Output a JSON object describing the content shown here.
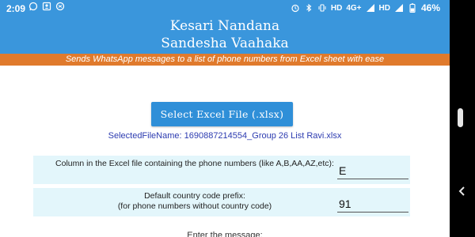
{
  "status_bar": {
    "time": "2:09",
    "left_icons": [
      "whatsapp-icon",
      "contact-icon",
      "sync-icon"
    ],
    "right_icons": [
      "alarm-icon",
      "bluetooth-icon",
      "vibrate-icon",
      "hd-icon",
      "signal-icon",
      "hd-icon",
      "signal-icon",
      "battery-icon"
    ],
    "hd1": "HD",
    "network": "4G+",
    "hd2": "HD",
    "battery": "46%"
  },
  "header": {
    "title_line1": "Kesari Nandana",
    "title_line2": "Sandesha Vaahaka",
    "subtitle": "Sends WhatsApp messages to a list of phone numbers from Excel sheet with ease",
    "bg_color": "#3a96dc",
    "subtitle_color": "#e07a2c"
  },
  "main": {
    "select_button_label": "Select Excel File (.xlsx)",
    "selected_file": "SelectedFileName: 1690887214554_Group 26 List Ravi.xlsx",
    "phone_column": {
      "label": "Column in the Excel file containing the phone numbers (like A,B,AA,AZ,etc):",
      "value": "E"
    },
    "country_code": {
      "label_line1": "Default country code prefix:",
      "label_line2": "(for phone numbers without country code)",
      "value": "91"
    },
    "enter_message_label": "Enter the message:"
  }
}
